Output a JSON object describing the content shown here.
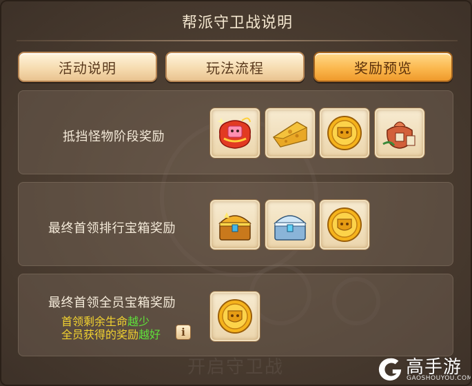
{
  "title": "帮派守卫战说明",
  "tabs": [
    {
      "label": "活动说明",
      "active": false
    },
    {
      "label": "玩法流程",
      "active": false
    },
    {
      "label": "奖励预览",
      "active": true
    }
  ],
  "sections": [
    {
      "label": "抵挡怪物阶段奖励",
      "items": [
        "lucky-bag-icon",
        "cheese-icon",
        "gold-coin-icon",
        "gift-sack-icon"
      ]
    },
    {
      "label": "最终首领排行宝箱奖励",
      "items": [
        "gold-chest-icon",
        "silver-chest-icon",
        "gold-coin-icon"
      ]
    },
    {
      "label": "最终首领全员宝箱奖励",
      "items": [
        "gold-coin-icon"
      ],
      "note": {
        "line1_prefix": "首领剩余生命",
        "line1_highlight": "越少",
        "line2_prefix": "全员获得的奖励",
        "line2_highlight": "越好"
      }
    }
  ],
  "info_button": "i",
  "background_button_text": "开启守卫战",
  "watermark": {
    "name": "高手游",
    "url": "GAOSHOUYOU.COM"
  },
  "colors": {
    "tab_active": "#fbb84e",
    "tab_inactive": "#f6dcb0",
    "note_yellow": "#f2d230",
    "note_green": "#5fe23a"
  }
}
